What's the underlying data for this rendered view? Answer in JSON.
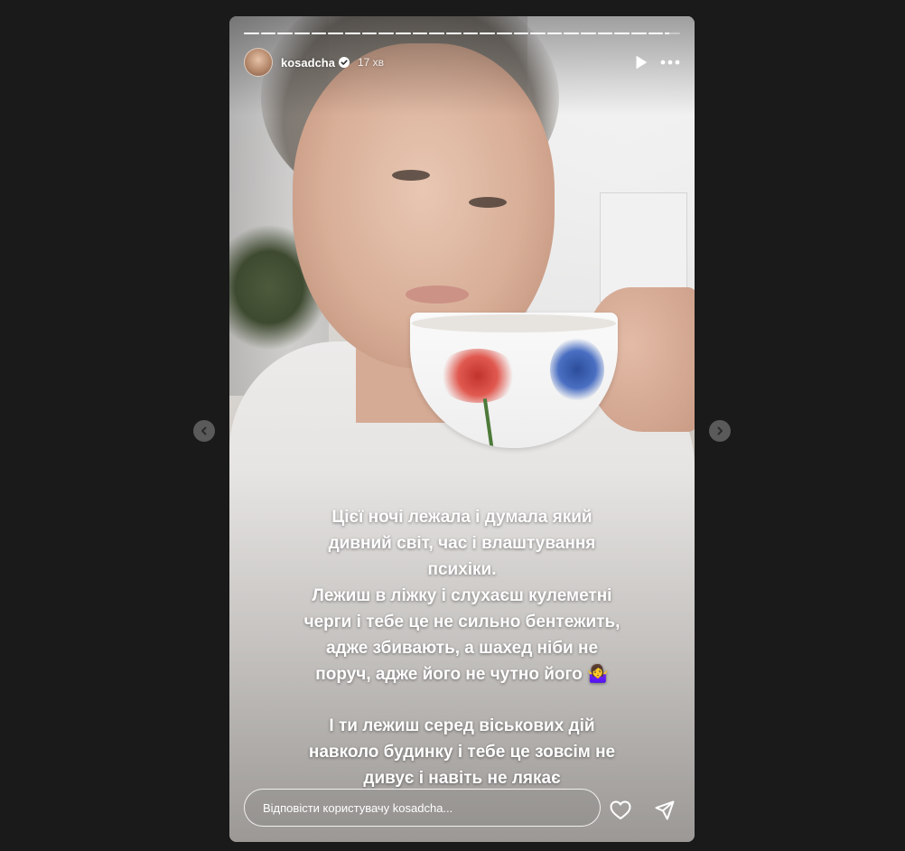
{
  "story": {
    "username": "kosadcha",
    "time_ago": "17 хв",
    "progress_segments": 26,
    "current_segment": 25,
    "current_segment_progress": 0.3,
    "caption_lines": [
      "Цієї ночі лежала і думала який",
      "дивний світ, час і влаштування",
      "психіки.",
      "Лежиш в ліжку і слухаєш кулеметні",
      "черги і тебе це не сильно бентежить,",
      "адже збивають, а шахед ніби не",
      "поруч, адже його не чутно його 🤷‍♀️",
      "І ти лежиш серед віськових дій",
      "навколо будинку і тебе це зовсім не",
      "дивує і навіть не лякає"
    ]
  },
  "header": {
    "avatar_icon": "avatar",
    "verified_icon": "verified-badge-icon",
    "play_icon": "play-icon",
    "more_icon": "more-icon"
  },
  "reply": {
    "placeholder": "Відповісти користувачу kosadcha...",
    "like_icon": "heart-icon",
    "share_icon": "send-icon"
  },
  "nav": {
    "prev_icon": "chevron-left-icon",
    "next_icon": "chevron-right-icon"
  }
}
